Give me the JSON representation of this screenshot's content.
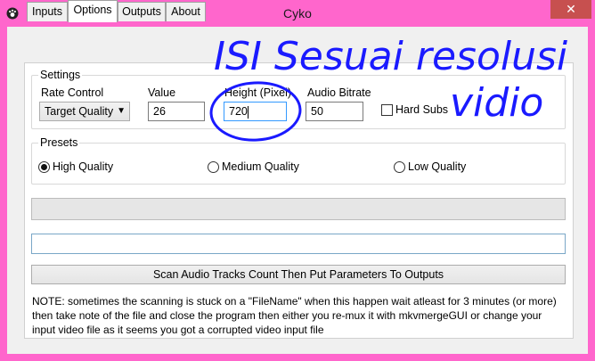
{
  "window": {
    "title": "Cyko",
    "close_glyph": "✕"
  },
  "tabs": [
    {
      "label": "Inputs",
      "active": false
    },
    {
      "label": "Options",
      "active": true
    },
    {
      "label": "Outputs",
      "active": false
    },
    {
      "label": "About",
      "active": false
    }
  ],
  "settings": {
    "group_label": "Settings",
    "rate_control_label": "Rate Control",
    "rate_control_value": "Target Quality",
    "value_label": "Value",
    "value_value": "26",
    "height_label": "Height (Pixel)",
    "height_value": "720",
    "audio_bitrate_label": "Audio Bitrate",
    "audio_bitrate_value": "50",
    "hard_subs_label": "Hard Subs",
    "hard_subs_checked": false
  },
  "presets": {
    "group_label": "Presets",
    "options": [
      {
        "label": "High Quality",
        "checked": true
      },
      {
        "label": "Medium Quality",
        "checked": false
      },
      {
        "label": "Low Quality",
        "checked": false
      }
    ]
  },
  "scan_button_label": "Scan Audio Tracks Count Then Put Parameters To Outputs",
  "note": "NOTE: sometimes the scanning is stuck on a \"FileName\" when this happen wait atleast for 3 minutes (or more) then take note of the file and close the program then either you re-mux it with mkvmergeGUI or change your input video file as it seems you got a corrupted video input file",
  "annotation": {
    "line1": "ISI  Sesuai  resolusi",
    "line2": "vidio",
    "color": "#1a1aff"
  },
  "colors": {
    "frame": "#ff66cc",
    "close_button": "#c7504f",
    "focus": "#3399ff"
  }
}
